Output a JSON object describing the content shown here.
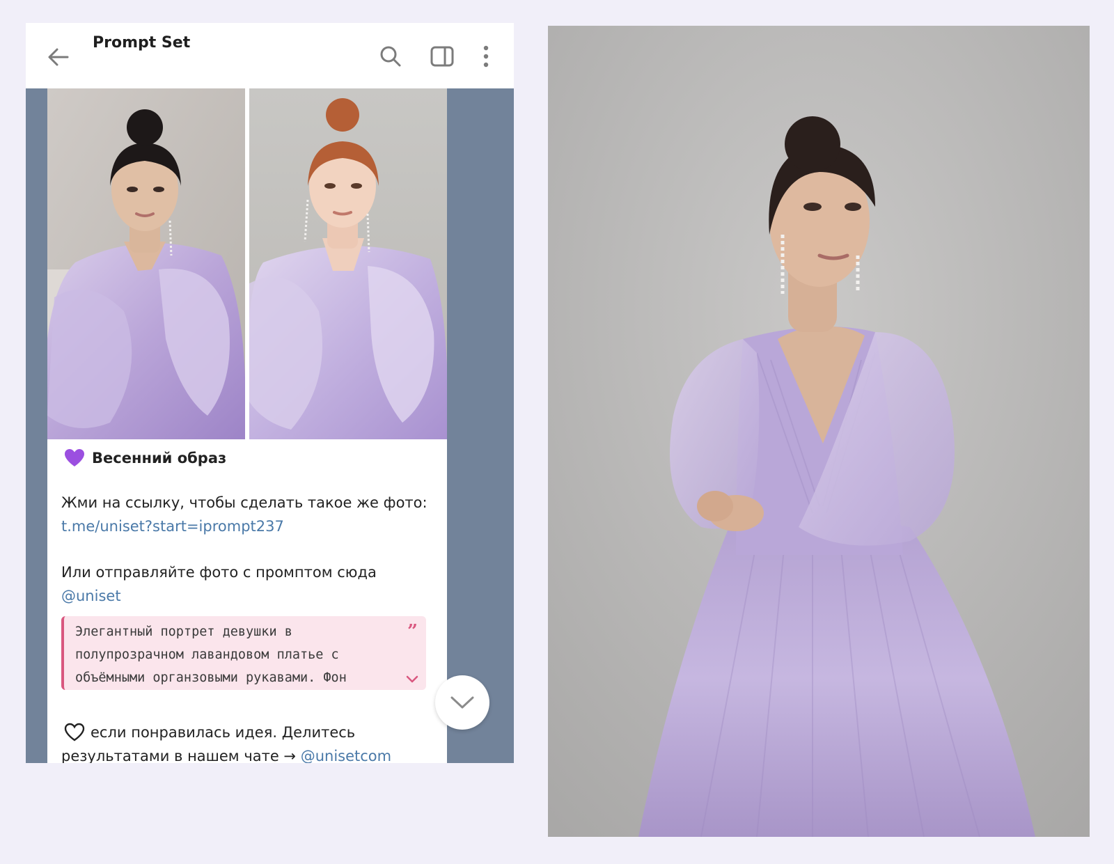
{
  "header": {
    "title": "Prompt Set"
  },
  "icons": {
    "back": "arrow-left-icon",
    "search": "search-icon",
    "panel": "sidebar-panel-icon",
    "more": "more-vertical-icon",
    "scroll": "chevron-down-icon"
  },
  "message": {
    "title": "Весенний образ",
    "line_1": "Жми на ссылку, чтобы сделать такое же фото:",
    "link_1": "t.me/uniset?start=iprompt237",
    "line_2": "Или отправляйте фото с промптом сюда",
    "link_2": "@uniset",
    "quote_lines": [
      "Элегантный портрет девушки в",
      "полупрозрачном лавандовом платье с",
      "объёмными органзовыми рукавами. Фон"
    ],
    "footer_line_1": "если понравилась идея. Делитесь",
    "footer_line_2_prefix": "результатами в нашем чате →",
    "footer_link": "@unisetcom"
  },
  "colors": {
    "page_bg": "#f1eff9",
    "chat_bg": "#72839a",
    "link": "#4a79a8",
    "quote_bg": "#fbe5ec",
    "quote_accent": "#d9577f",
    "dress_lavender": "#b7a6d6"
  }
}
